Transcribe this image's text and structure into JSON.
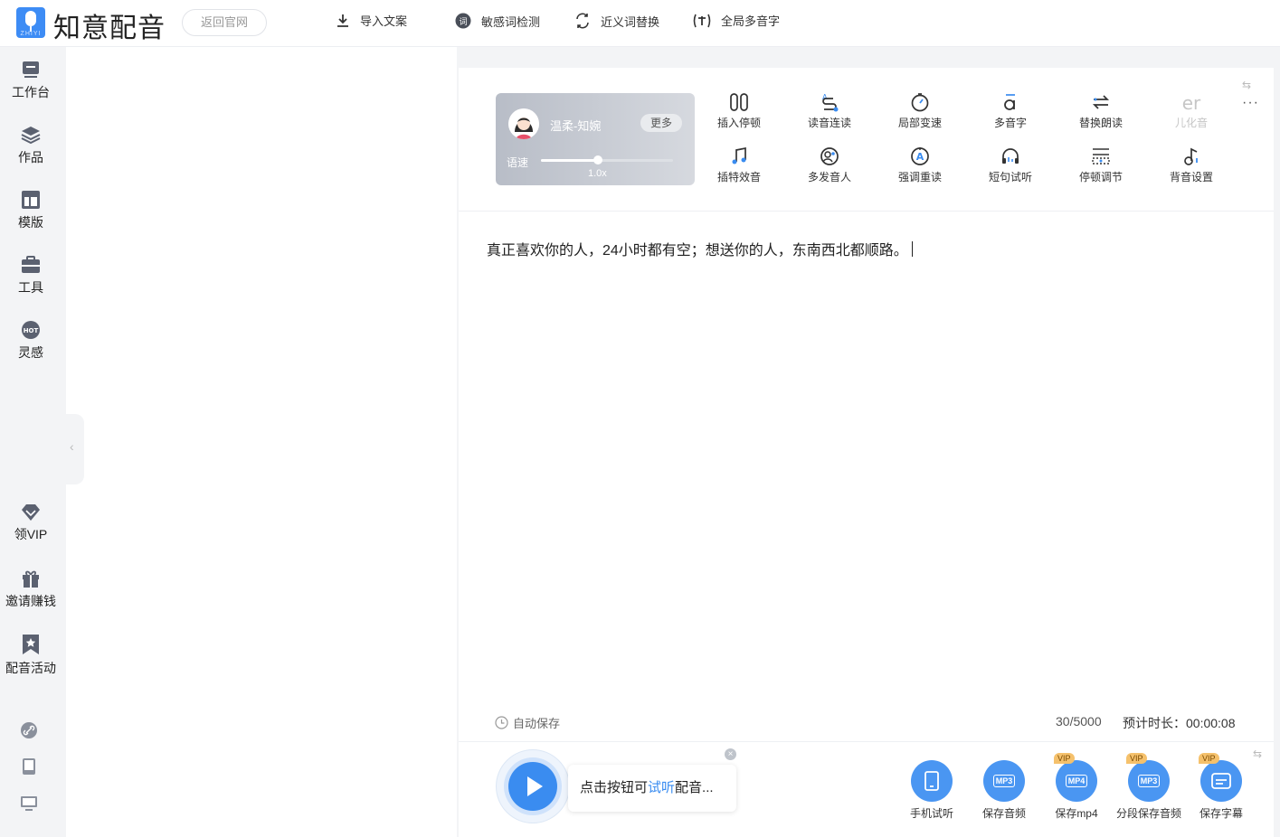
{
  "header": {
    "brand": "知意配音",
    "logo_small_text": "ZHIYI",
    "back_button": "返回官网",
    "nav": [
      {
        "label": "导入文案",
        "icon": "import-icon"
      },
      {
        "label": "敏感词检测",
        "icon": "sensitive-word-icon"
      },
      {
        "label": "近义词替换",
        "icon": "synonym-replace-icon"
      },
      {
        "label": "全局多音字",
        "icon": "polyphone-global-icon"
      }
    ]
  },
  "sidebar": {
    "items": [
      {
        "label": "工作台",
        "icon": "workbench-icon"
      },
      {
        "label": "作品",
        "icon": "works-layers-icon"
      },
      {
        "label": "模版",
        "icon": "template-icon"
      },
      {
        "label": "工具",
        "icon": "toolbox-icon"
      },
      {
        "label": "灵感",
        "icon": "inspiration-hot-icon"
      }
    ],
    "hot_badge": "HOT",
    "bottom_items": [
      {
        "label": "领VIP",
        "icon": "diamond-icon"
      },
      {
        "label": "邀请赚钱",
        "icon": "gift-icon"
      },
      {
        "label": "配音活动",
        "icon": "bookmark-star-icon"
      }
    ],
    "small_icons": [
      "link-icon",
      "tablet-icon",
      "monitor-icon"
    ],
    "collapse_glyph": "‹"
  },
  "voice_card": {
    "name": "温柔-知婉",
    "more_label": "更多",
    "speed_label": "语速",
    "speed_value": "1.0x",
    "speed_fraction": 0.43
  },
  "tools": [
    {
      "label": "插入停顿",
      "icon": "insert-pause-icon"
    },
    {
      "label": "读音连读",
      "icon": "liaison-icon"
    },
    {
      "label": "局部变速",
      "icon": "local-speed-icon"
    },
    {
      "label": "多音字",
      "icon": "polyphone-icon"
    },
    {
      "label": "替换朗读",
      "icon": "replace-read-icon"
    },
    {
      "label": "儿化音",
      "icon": "erhua-icon",
      "icon_text": "er",
      "disabled": true
    },
    {
      "label": "插特效音",
      "icon": "sound-effect-icon"
    },
    {
      "label": "多发音人",
      "icon": "multi-speaker-icon"
    },
    {
      "label": "强调重读",
      "icon": "emphasis-icon"
    },
    {
      "label": "短句试听",
      "icon": "headphone-icon"
    },
    {
      "label": "停顿调节",
      "icon": "pause-adjust-icon"
    },
    {
      "label": "背音设置",
      "icon": "bgm-icon"
    }
  ],
  "more_glyph": "···",
  "swap_glyph": "⇆",
  "content": {
    "text": "真正喜欢你的人，24小时都有空；想送你的人，东南西北都顺路。"
  },
  "status": {
    "autosave": "自动保存",
    "count": "30/5000",
    "duration": "预计时长：00:00:08"
  },
  "player": {
    "hint_before": "点击按钮可",
    "hint_link": "试听",
    "hint_after": "配音...",
    "close_glyph": "×"
  },
  "save_actions": [
    {
      "label": "手机试听",
      "icon": "phone-icon",
      "vip": false
    },
    {
      "label": "保存音频",
      "icon": "mp3-icon",
      "fmt": "MP3",
      "vip": false
    },
    {
      "label": "保存mp4",
      "icon": "mp4-icon",
      "fmt": "MP4",
      "vip": true
    },
    {
      "label": "分段保存音频",
      "icon": "mp3-segment-icon",
      "fmt": "MP3",
      "vip": true
    },
    {
      "label": "保存字幕",
      "icon": "subtitle-icon",
      "vip": true
    }
  ],
  "vip_badge": "VIP",
  "colors": {
    "accent": "#3a8cf0",
    "save_blue": "#4a96f2",
    "vip_gold": "#f5c16c"
  }
}
